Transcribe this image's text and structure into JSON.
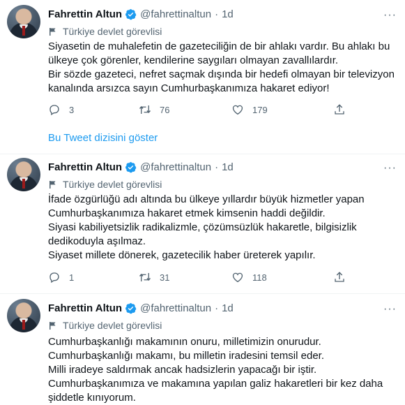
{
  "tweets": [
    {
      "name": "Fahrettin Altun",
      "handle": "@fahrettinaltun",
      "separator": "·",
      "time": "1d",
      "label": "Türkiye devlet görevlisi",
      "lines": [
        "Siyasetin de muhalefetin de gazeteciliğin de bir ahlakı vardır. Bu ahlakı bu",
        "ülkeye çok görenler, kendilerine saygıları olmayan zavallılardır.",
        "Bir sözde gazeteci, nefret saçmak dışında bir hedefi olmayan bir televizyon",
        "kanalında arsızca sayın Cumhurbaşkanımıza hakaret ediyor!"
      ],
      "replies": "3",
      "retweets": "76",
      "likes": "179"
    },
    {
      "name": "Fahrettin Altun",
      "handle": "@fahrettinaltun",
      "separator": "·",
      "time": "1d",
      "label": "Türkiye devlet görevlisi",
      "lines": [
        "İfade özgürlüğü adı altında bu ülkeye yıllardır büyük hizmetler yapan",
        "Cumhurbaşkanımıza hakaret etmek kimsenin haddi değildir.",
        "Siyasi kabiliyetsizlik radikalizmle, çözümsüzlük hakaretle, bilgisizlik",
        "dedikoduyla aşılmaz.",
        "Siyaset millete dönerek, gazetecilik haber üreterek yapılır."
      ],
      "replies": "1",
      "retweets": "31",
      "likes": "118"
    },
    {
      "name": "Fahrettin Altun",
      "handle": "@fahrettinaltun",
      "separator": "·",
      "time": "1d",
      "label": "Türkiye devlet görevlisi",
      "lines": [
        "Cumhurbaşkanlığı makamının onuru, milletimizin onurudur.",
        "Cumhurbaşkanlığı makamı, bu milletin iradesini temsil eder.",
        "Milli iradeye saldırmak ancak hadsizlerin yapacağı bir iştir.",
        "Cumhurbaşkanımıza ve makamına yapılan galiz hakaretleri bir kez daha",
        "şiddetle kınıyorum."
      ]
    }
  ],
  "thread_link": "Bu Tweet dizisini göster",
  "more_label": "···",
  "colors": {
    "accent": "#1d9bf0",
    "secondary": "#536471",
    "text": "#0f1419"
  },
  "icons": [
    "verified-badge-icon",
    "flag-icon",
    "reply-icon",
    "retweet-icon",
    "like-icon",
    "share-icon",
    "more-icon"
  ]
}
